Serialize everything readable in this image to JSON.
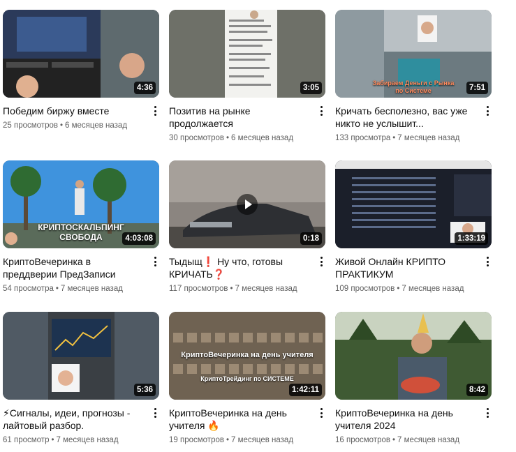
{
  "videos": [
    {
      "title": "Победим биржу вместе",
      "duration": "4:36",
      "views": "25 просмотров",
      "age": "6 месяцев назад"
    },
    {
      "title": "Позитив на рынке продолжается",
      "duration": "3:05",
      "views": "30 просмотров",
      "age": "6 месяцев назад"
    },
    {
      "title": "Кричать бесполезно, вас уже никто не услышит...",
      "duration": "7:51",
      "views": "133 просмотра",
      "age": "7 месяцев назад",
      "caption": "Забираем Деньги с Рынка по Системе"
    },
    {
      "title": "КриптоВечеринка в преддверии ПредЗаписи",
      "duration": "4:03:08",
      "views": "54 просмотра",
      "age": "7 месяцев назад",
      "caption1": "КРИПТОСКАЛЬПИНГ",
      "caption2": "СВОБОДА"
    },
    {
      "title": "Тыдыщ❗ Ну что, готовы КРИЧАТЬ❓",
      "duration": "0:18",
      "views": "117 просмотров",
      "age": "7 месяцев назад"
    },
    {
      "title": "Живой Онлайн КРИПТО ПРАКТИКУМ",
      "duration": "1:33:19",
      "views": "109 просмотров",
      "age": "7 месяцев назад"
    },
    {
      "title": "⚡Сигналы, идеи, прогнозы - лайтовый разбор.",
      "duration": "5:36",
      "views": "61 просмотр",
      "age": "7 месяцев назад"
    },
    {
      "title": "КриптоВечеринка на день учителя 🔥",
      "duration": "1:42:11",
      "views": "19 просмотров",
      "age": "7 месяцев назад",
      "caption1": "КриптоВечеринка на день учителя",
      "caption2": "КриптоТрейдинг по СИСТЕМЕ"
    },
    {
      "title": "КриптоВечеринка на день учителя 2024",
      "duration": "8:42",
      "views": "16 просмотров",
      "age": "7 месяцев назад"
    }
  ]
}
